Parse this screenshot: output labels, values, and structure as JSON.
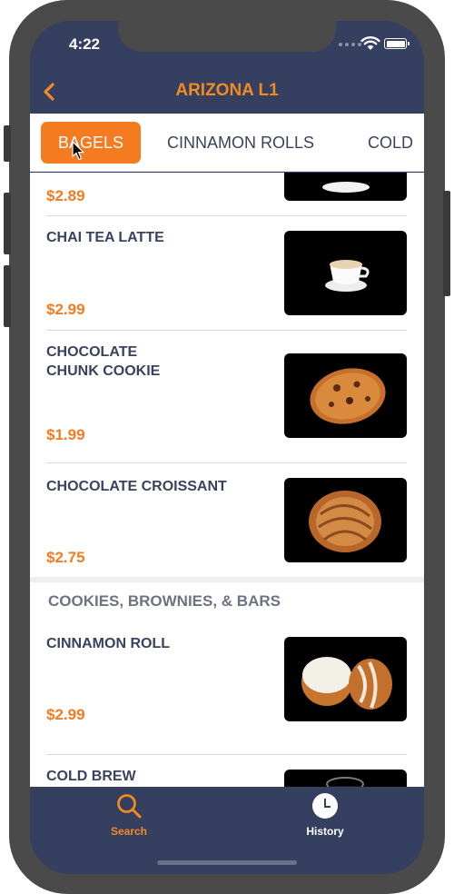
{
  "status_bar": {
    "time": "4:22"
  },
  "nav": {
    "title": "ARIZONA L1",
    "back_icon": "chevron-left-icon"
  },
  "category_tabs": [
    {
      "label": "BAGELS",
      "active": true
    },
    {
      "label": "CINNAMON ROLLS",
      "active": false
    },
    {
      "label": "COLD",
      "active": false
    }
  ],
  "menu": {
    "partial_item": {
      "price": "$2.89"
    },
    "items": [
      {
        "name": "CHAI TEA LATTE",
        "price": "$2.99"
      },
      {
        "name": "CHOCOLATE CHUNK COOKIE",
        "price": "$1.99"
      },
      {
        "name": "CHOCOLATE CROISSANT",
        "price": "$2.75"
      }
    ],
    "section_title": "COOKIES, BROWNIES, & BARS",
    "section_items": [
      {
        "name": "CINNAMON ROLL",
        "price": "$2.99"
      },
      {
        "name": "COLD BREW",
        "price": ""
      }
    ]
  },
  "tab_bar": {
    "search_label": "Search",
    "search_icon": "search-icon",
    "history_label": "History",
    "history_icon": "clock-icon"
  },
  "colors": {
    "navy": "#353f60",
    "accent_orange": "#f47b20",
    "text_dark": "#3a4260"
  }
}
